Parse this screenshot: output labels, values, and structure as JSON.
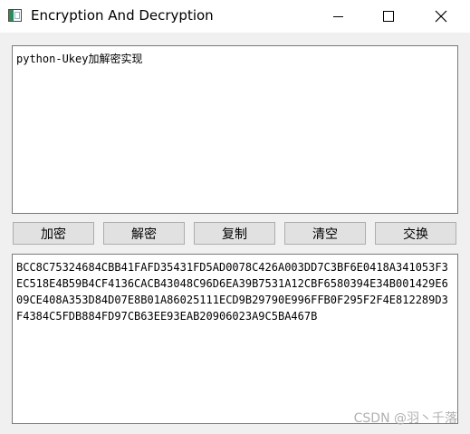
{
  "window": {
    "title": "Encryption And Decryption",
    "icon": "app-window-icon"
  },
  "title_controls": {
    "minimize_icon": "minimize-icon",
    "maximize_icon": "maximize-icon",
    "close_icon": "close-icon"
  },
  "input": {
    "value": "python-Ukey加解密实现"
  },
  "buttons": {
    "encrypt": "加密",
    "decrypt": "解密",
    "copy": "复制",
    "clear": "清空",
    "swap": "交换"
  },
  "output": {
    "value": "BCC8C75324684CBB41FAFD35431FD5AD0078C426A003DD7C3BF6E0418A341053F3EC518E4B59B4CF4136CACB43048C96D6EA39B7531A12CBF6580394E34B001429E609CE408A353D84D07E8B01A86025111ECD9B29790E996FFB0F295F2F4E812289D3F4384C5FDB884FD97CB63EE93EAB20906023A9C5BA467B"
  },
  "watermark": "CSDN @羽丶千落"
}
